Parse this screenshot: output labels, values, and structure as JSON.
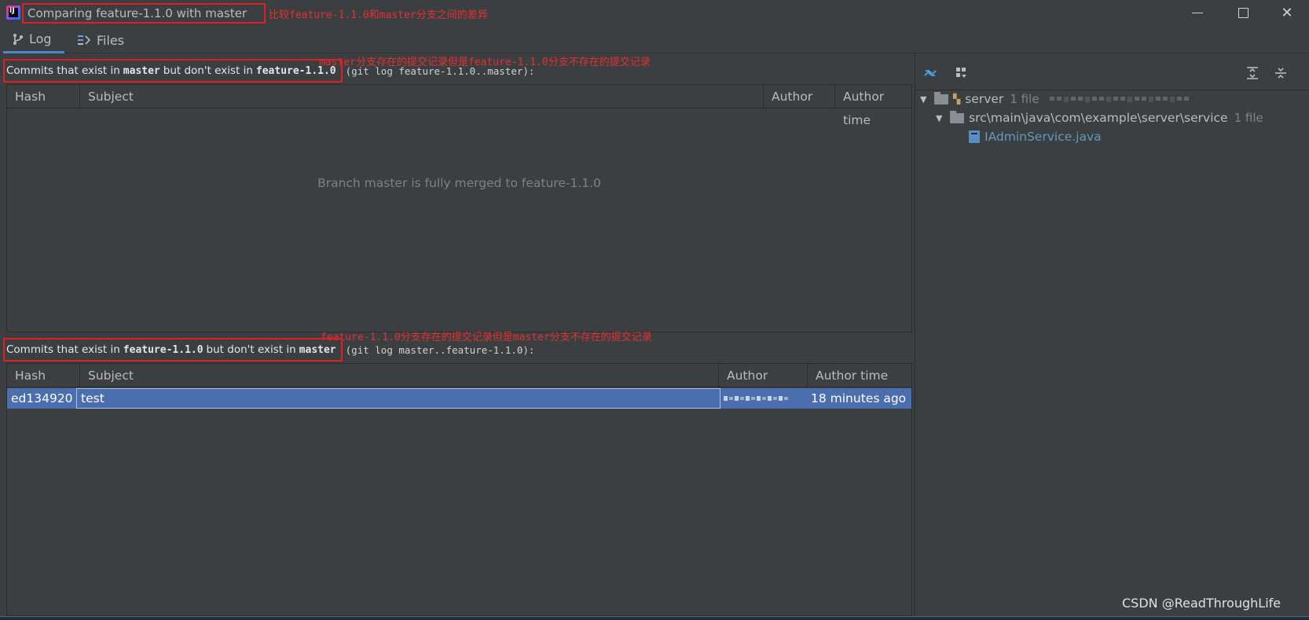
{
  "window": {
    "title": "Comparing feature-1.1.0 with master",
    "annotation_title": "比较feature-1.1.0和master分支之间的差异"
  },
  "tabs": [
    {
      "label": "Log",
      "icon": "branch-log-icon",
      "active": true
    },
    {
      "label": "Files",
      "icon": "files-diff-icon",
      "active": false
    }
  ],
  "top_section": {
    "annotation": "master分支存在的提交记录但是feature-1.1.0分支不存在的提交记录",
    "label_prefix": "Commits that exist in",
    "label_branch1": "master",
    "label_middle": "but don't exist in",
    "label_branch2": "feature-1.1.0",
    "git_command": "(git log feature-1.1.0..master):",
    "columns": [
      "Hash",
      "Subject",
      "Author",
      "Author time"
    ],
    "empty_message": "Branch master is fully merged to feature-1.1.0"
  },
  "bottom_section": {
    "annotation": "feature-1.1.0分支存在的提交记录但是master分支不存在的提交记录",
    "label_prefix": "Commits that exist in",
    "label_branch1": "feature-1.1.0",
    "label_middle": "but don't exist in",
    "label_branch2": "master",
    "git_command": "(git log master..feature-1.1.0):",
    "columns": [
      "Hash",
      "Subject",
      "Author",
      "Author time"
    ],
    "rows": [
      {
        "hash": "ed134920",
        "subject": "test",
        "author_time": "18 minutes ago",
        "selected": true
      }
    ]
  },
  "changes_tree": {
    "root": {
      "name": "server",
      "count": "1 file"
    },
    "package": {
      "path": "src\\main\\java\\com\\example\\server\\service",
      "count": "1 file"
    },
    "file": {
      "name": "IAdminService.java"
    }
  },
  "watermark": "CSDN @ReadThroughLife",
  "colors": {
    "background": "#3c3f41",
    "selection": "#4b6eaf",
    "annotation_red": "#e53030",
    "link_blue": "#6897bb"
  }
}
